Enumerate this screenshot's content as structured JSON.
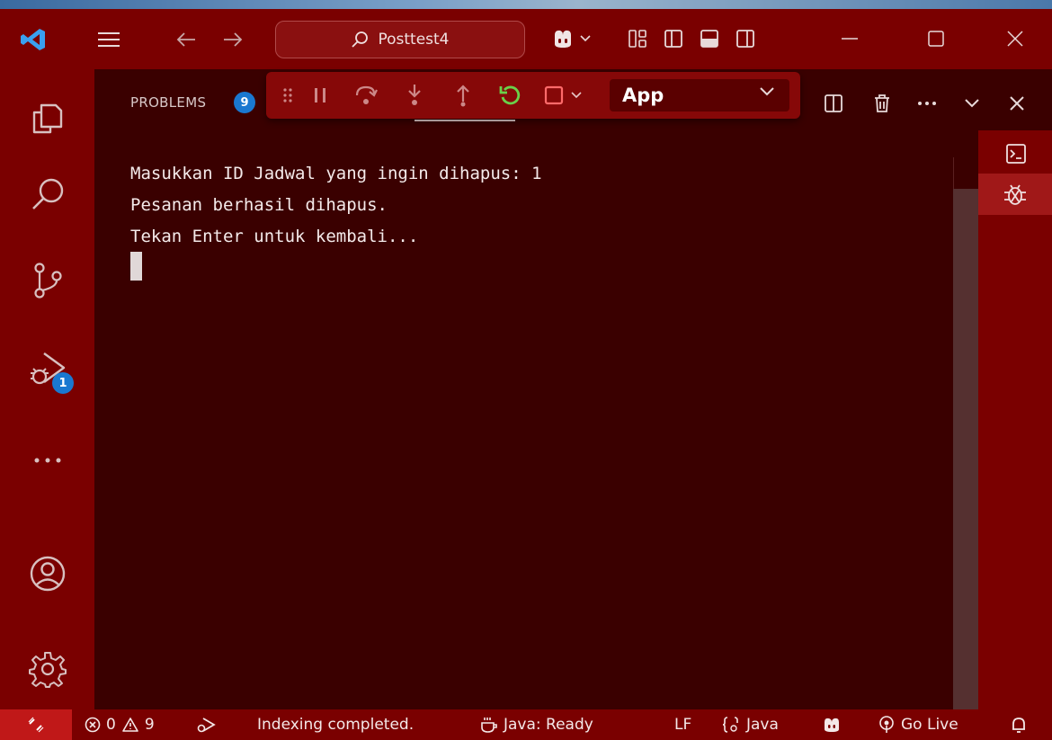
{
  "titlebar": {
    "search_text": "Posttest4"
  },
  "activity_bar": {
    "run_debug_badge": "1"
  },
  "panel": {
    "problems_label": "PROBLEMS",
    "problems_count": "9"
  },
  "debug_toolbar": {
    "config_name": "App"
  },
  "terminal": {
    "lines": [
      "Masukkan ID Jadwal yang ingin dihapus: 1",
      "Pesanan berhasil dihapus.",
      "Tekan Enter untuk kembali..."
    ]
  },
  "statusbar": {
    "errors": "0",
    "warnings": "9",
    "indexing": "Indexing completed.",
    "java_status": "Java: Ready",
    "eol": "LF",
    "language": "Java",
    "go_live": "Go Live"
  },
  "colors": {
    "titlebar_bg": "#7a0000",
    "editor_bg": "#3a0000",
    "badge_blue": "#1a78d0",
    "restart_green": "#6ad04a",
    "stop_red": "#ff6a6a"
  },
  "icons": [
    "vscode-logo-icon",
    "menu-icon",
    "arrow-left-icon",
    "arrow-right-icon",
    "search-icon",
    "copilot-icon",
    "chevron-down-icon",
    "customize-layout-icon",
    "toggle-primary-sidebar-icon",
    "toggle-panel-icon",
    "toggle-secondary-sidebar-icon",
    "minimize-icon",
    "maximize-icon",
    "close-icon",
    "explorer-icon",
    "search-view-icon",
    "source-control-icon",
    "run-debug-icon",
    "more-icon",
    "account-icon",
    "settings-gear-icon",
    "drag-grip-icon",
    "pause-icon",
    "step-over-icon",
    "step-into-icon",
    "step-out-icon",
    "restart-icon",
    "stop-icon",
    "split-terminal-icon",
    "trash-icon",
    "ellipsis-icon",
    "terminal-icon",
    "debug-console-icon",
    "remote-icon",
    "error-icon",
    "warning-icon",
    "debug-broadcast-icon",
    "coffee-icon",
    "braces-icon",
    "broadcast-icon",
    "bell-icon"
  ]
}
